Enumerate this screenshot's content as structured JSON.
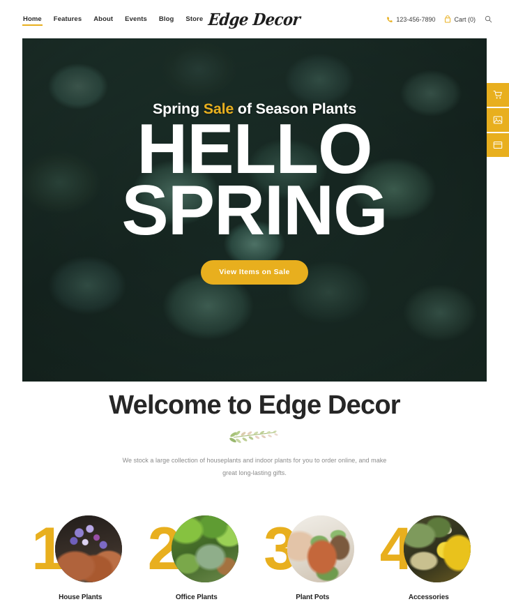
{
  "header": {
    "nav": [
      {
        "label": "Home",
        "active": true
      },
      {
        "label": "Features",
        "active": false
      },
      {
        "label": "About",
        "active": false
      },
      {
        "label": "Events",
        "active": false
      },
      {
        "label": "Blog",
        "active": false
      },
      {
        "label": "Store",
        "active": false
      }
    ],
    "logo": "Edge Decor",
    "phone": "123-456-7890",
    "phone_icon": "phone-icon",
    "cart": "Cart (0)",
    "cart_icon": "shopping-bag-icon",
    "search_icon": "search-icon"
  },
  "hero": {
    "subtitle_before": "Spring ",
    "subtitle_accent": "Sale",
    "subtitle_after": " of Season Plants",
    "title_line1": "HELLO",
    "title_line2": "SPRING",
    "cta_label": "View Items on Sale"
  },
  "side_buttons": [
    {
      "name": "cart-icon",
      "label": "Cart"
    },
    {
      "name": "image-icon",
      "label": "Gallery"
    },
    {
      "name": "window-icon",
      "label": "Layouts"
    }
  ],
  "welcome": {
    "title": "Welcome to Edge Decor",
    "divider_icon": "leaf-branch-ornament",
    "text": "We stock a large collection of houseplants and indoor plants for you to order online, and make great long-lasting gifts."
  },
  "categories": [
    {
      "number": "1",
      "label": "House Plants",
      "photo": "house-plants-photo"
    },
    {
      "number": "2",
      "label": "Office Plants",
      "photo": "office-plants-photo"
    },
    {
      "number": "3",
      "label": "Plant Pots",
      "photo": "plant-pots-photo"
    },
    {
      "number": "4",
      "label": "Accessories",
      "photo": "accessories-photo"
    }
  ],
  "colors": {
    "accent_gold": "#e8af1e",
    "text_dark": "#262626",
    "text_muted": "#8a8a8a",
    "white": "#ffffff"
  }
}
